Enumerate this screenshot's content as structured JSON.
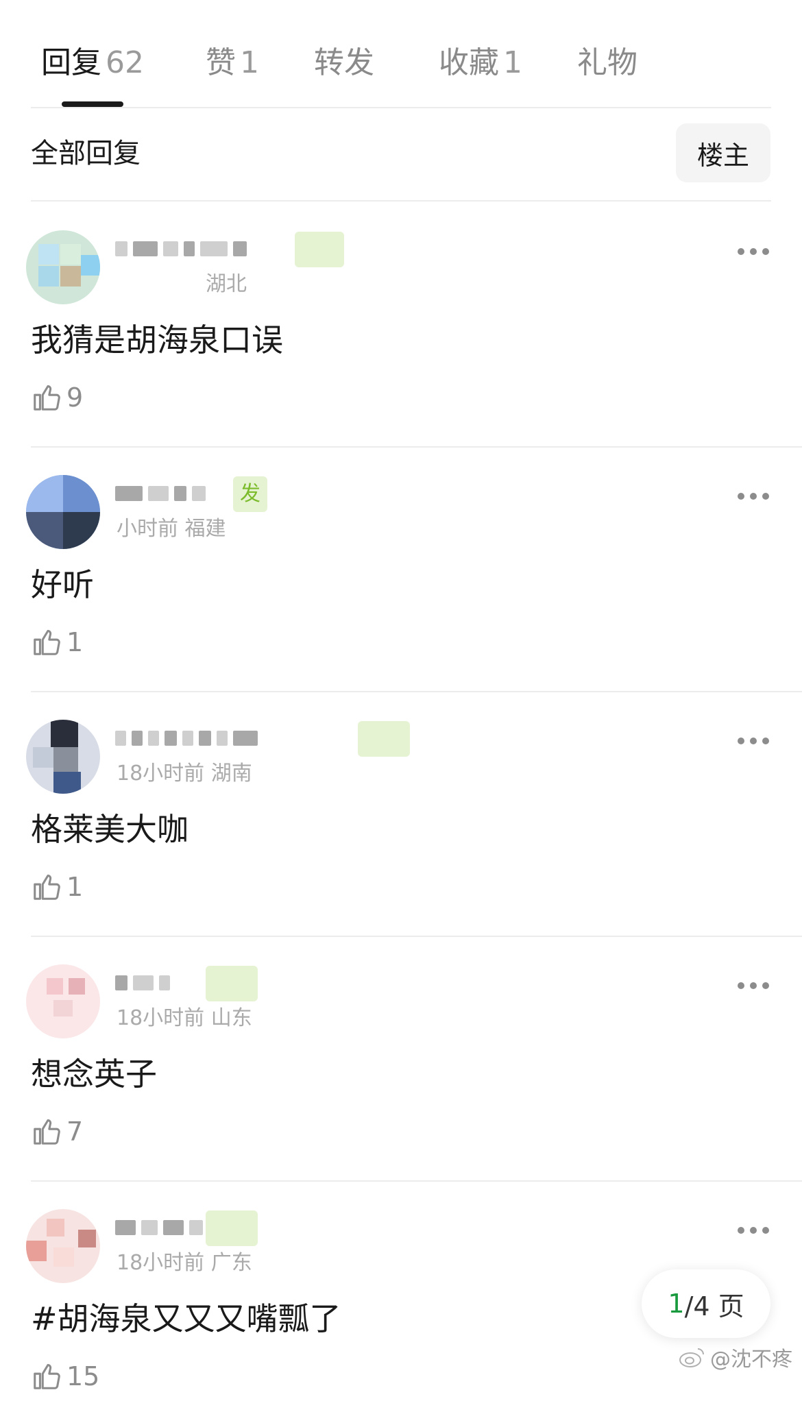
{
  "tabs": [
    {
      "label": "回复",
      "count": "62",
      "active": true
    },
    {
      "label": "赞",
      "count": "1",
      "active": false
    },
    {
      "label": "转发",
      "count": "",
      "active": false
    },
    {
      "label": "收藏",
      "count": "1",
      "active": false
    },
    {
      "label": "礼物",
      "count": "",
      "active": false
    }
  ],
  "filter": {
    "label": "全部回复",
    "owner_button": "楼主"
  },
  "comments": [
    {
      "meta": "湖北",
      "badge": "",
      "content": "我猜是胡海泉口误",
      "likes": "9"
    },
    {
      "meta": "小时前 福建",
      "badge": "发",
      "content": "好听",
      "likes": "1"
    },
    {
      "meta": "18小时前 湖南",
      "badge": "",
      "content": "格莱美大咖",
      "likes": "1"
    },
    {
      "meta": "18小时前 山东",
      "badge": "",
      "content": "想念英子",
      "likes": "7"
    },
    {
      "meta": "18小时前 广东",
      "badge": "",
      "content": "#胡海泉又又又嘴瓢了",
      "likes": "15"
    }
  ],
  "pager": {
    "current": "1",
    "total_text": "/4 页"
  },
  "watermark": "@沈不疼",
  "colors": {
    "accent_green": "#1a9a3e",
    "badge_bg": "#e6f3d3",
    "badge_text": "#7cbc2c"
  }
}
